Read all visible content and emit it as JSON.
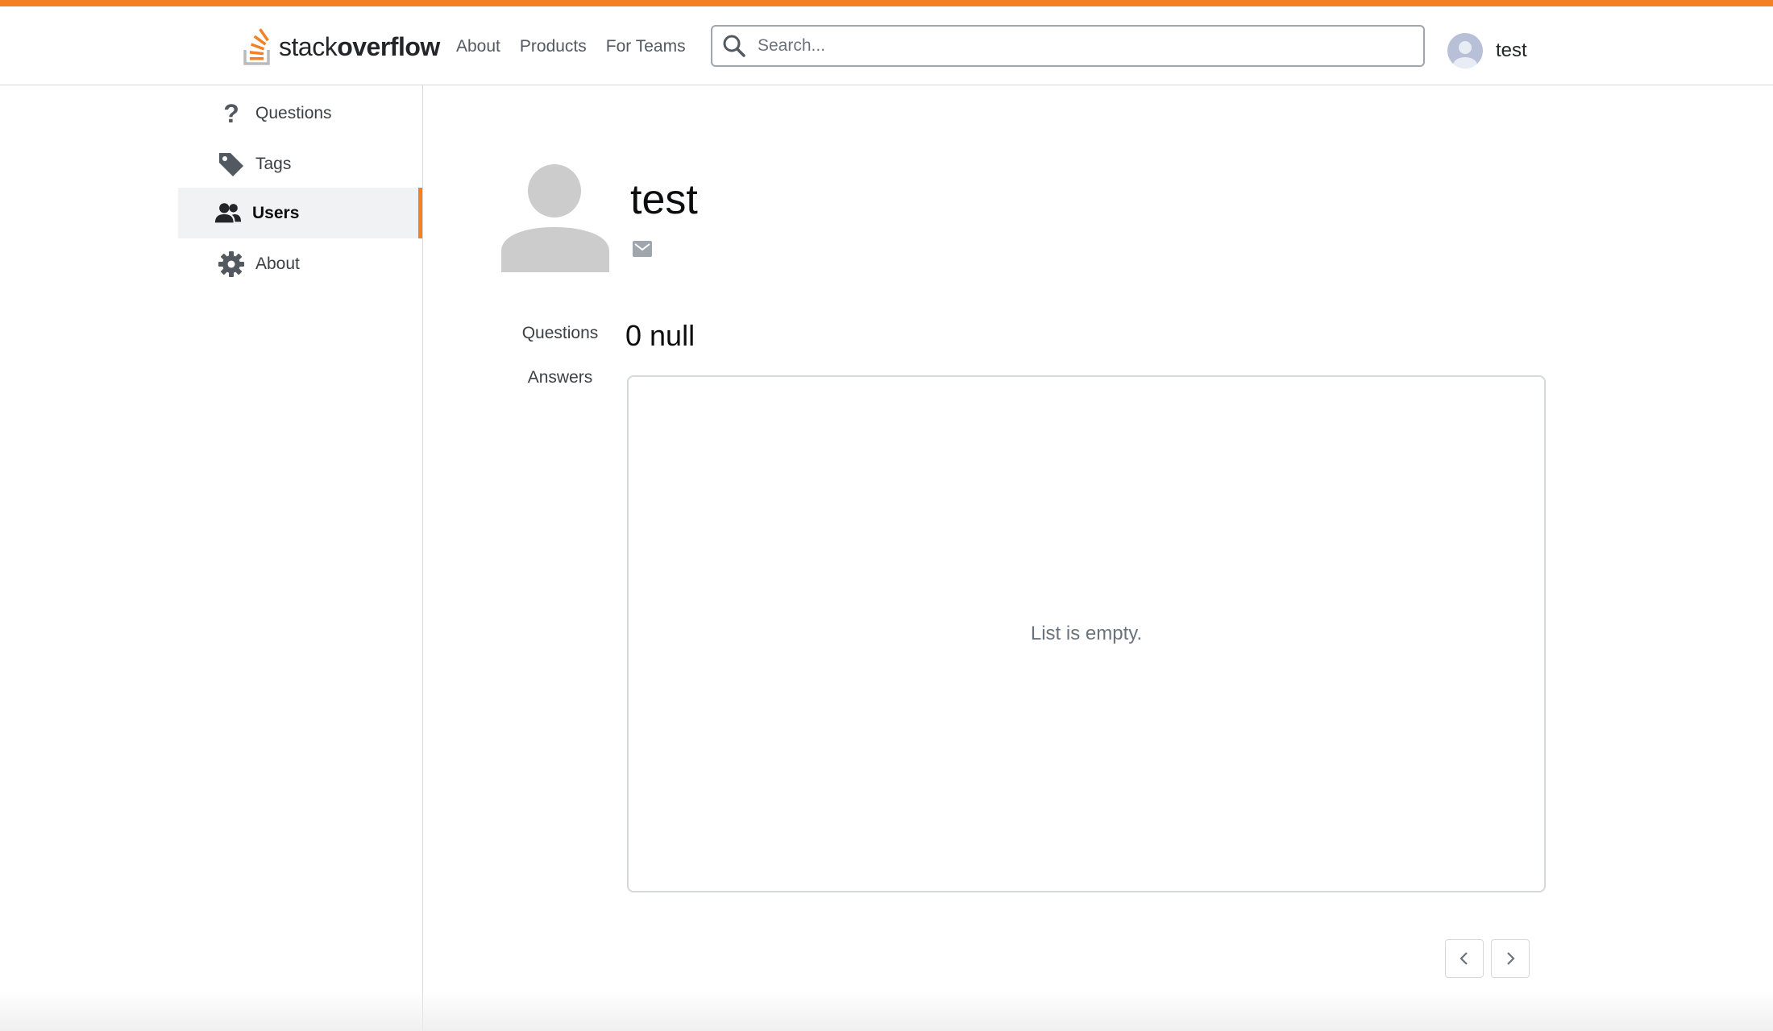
{
  "header": {
    "logo": {
      "text_light": "stack",
      "text_bold": "overflow"
    },
    "nav": [
      "About",
      "Products",
      "For Teams"
    ],
    "search": {
      "placeholder": "Search...",
      "value": ""
    },
    "user": {
      "name": "test"
    },
    "accent_color": "#f48024"
  },
  "sidebar": {
    "items": [
      {
        "label": "Questions",
        "icon": "question-mark-icon",
        "active": false
      },
      {
        "label": "Tags",
        "icon": "tag-icon",
        "active": false
      },
      {
        "label": "Users",
        "icon": "users-icon",
        "active": true
      },
      {
        "label": "About",
        "icon": "gear-icon",
        "active": false
      }
    ]
  },
  "profile": {
    "name": "test",
    "tabs": [
      "Questions",
      "Answers"
    ],
    "count_title": "0 null",
    "list": {
      "empty_text": "List is empty."
    }
  },
  "icons": {
    "search": "search-icon",
    "mail": "mail-icon",
    "prev": "chevron-left-icon",
    "next": "chevron-right-icon"
  }
}
